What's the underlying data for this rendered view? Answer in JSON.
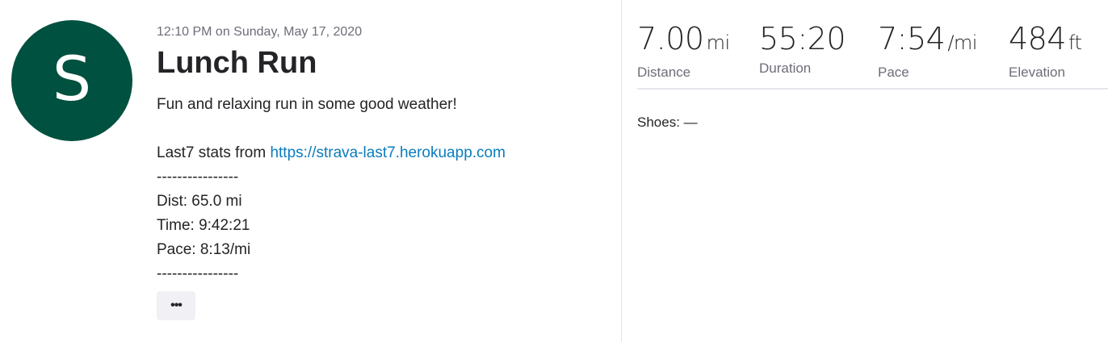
{
  "athlete": {
    "initial": "S"
  },
  "activity": {
    "timestamp": "12:10 PM on Sunday, May 17, 2020",
    "title": "Lunch Run",
    "description": {
      "line1": "Fun and relaxing run in some good weather!",
      "stats_prefix": "Last7 stats from ",
      "link": "https://strava-last7.herokuapp.com",
      "sep1": "----------------",
      "dist": "Dist: 65.0 mi",
      "time": "Time: 9:42:21",
      "pace": "Pace: 8:13/mi",
      "sep2": "----------------"
    },
    "more_label": "•••"
  },
  "stats": {
    "distance": {
      "value": "7.00",
      "unit": "mi",
      "label": "Distance"
    },
    "duration": {
      "value": "55:20",
      "unit": "",
      "label": "Duration"
    },
    "pace": {
      "value": "7:54",
      "unit": "/mi",
      "label": "Pace"
    },
    "elevation": {
      "value": "484",
      "unit": "ft",
      "label": "Elevation"
    }
  },
  "gear": {
    "shoes_label": "Shoes: —"
  }
}
